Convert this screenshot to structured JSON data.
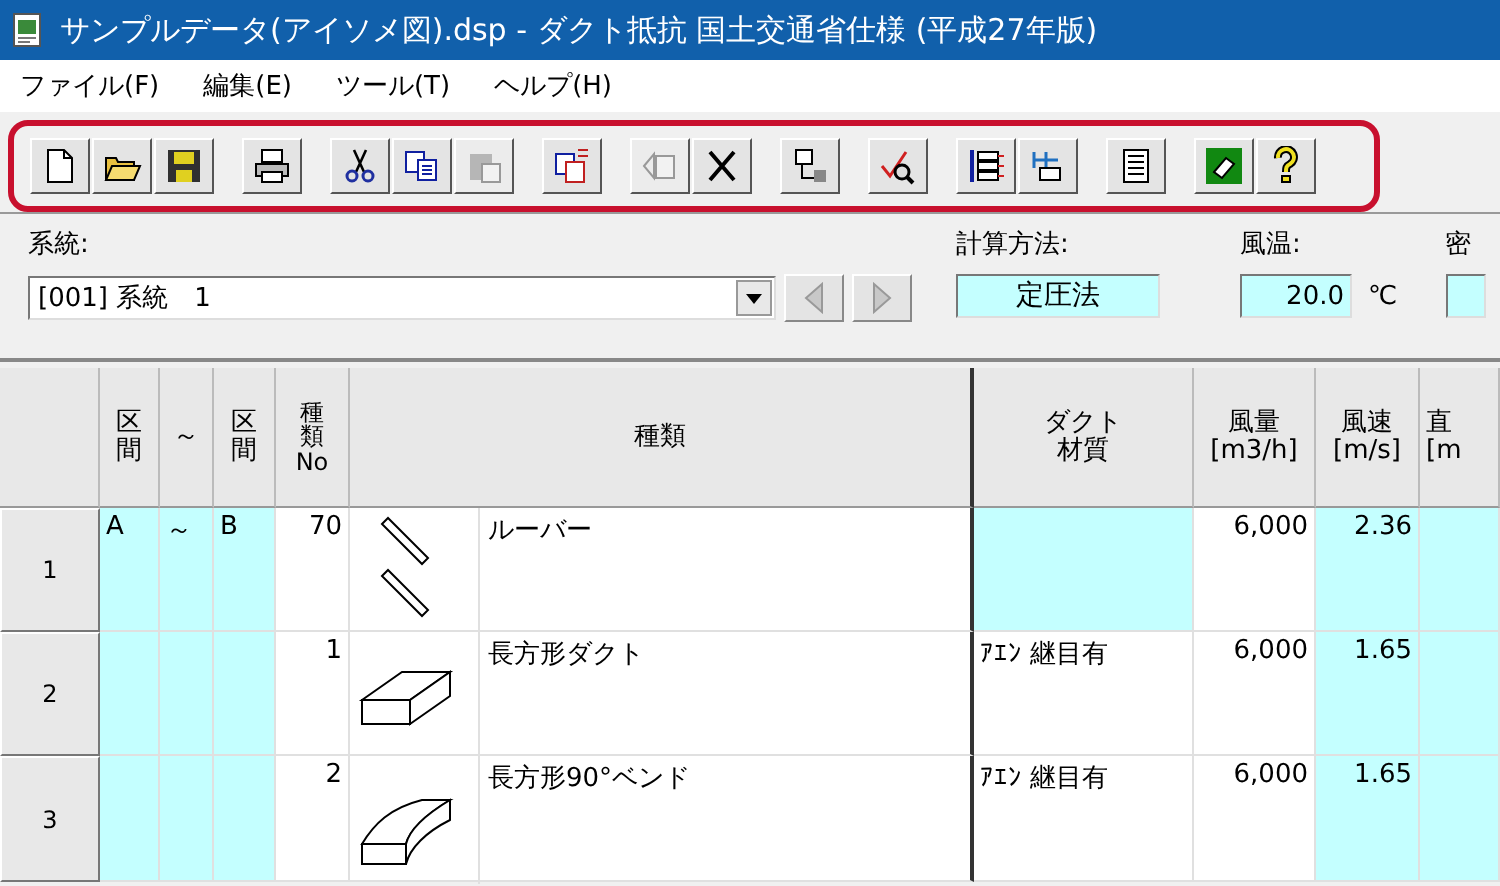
{
  "window": {
    "title": "サンプルデータ(アイソメ図).dsp - ダクト抵抗 国土交通省仕様 (平成27年版)"
  },
  "menu": [
    "ファイル(F)",
    "編集(E)",
    "ツール(T)",
    "ヘルプ(H)"
  ],
  "toolbar": {
    "highlighted": true,
    "groups": [
      [
        {
          "kind": "new",
          "disabled": false
        },
        {
          "kind": "open",
          "disabled": false
        },
        {
          "kind": "save",
          "disabled": false
        }
      ],
      [
        {
          "kind": "print",
          "disabled": false
        }
      ],
      [
        {
          "kind": "cut",
          "disabled": false
        },
        {
          "kind": "copy",
          "disabled": false
        },
        {
          "kind": "paste",
          "disabled": true
        }
      ],
      [
        {
          "kind": "export",
          "disabled": false
        }
      ],
      [
        {
          "kind": "insert",
          "disabled": true
        },
        {
          "kind": "delete",
          "disabled": false
        }
      ],
      [
        {
          "kind": "move",
          "disabled": false
        }
      ],
      [
        {
          "kind": "check",
          "disabled": false
        }
      ],
      [
        {
          "kind": "tree",
          "disabled": false
        },
        {
          "kind": "network",
          "disabled": false
        }
      ],
      [
        {
          "kind": "list",
          "disabled": false
        }
      ],
      [
        {
          "kind": "eraser",
          "disabled": false
        },
        {
          "kind": "help",
          "disabled": false
        }
      ]
    ]
  },
  "form": {
    "system": {
      "label": "系統:",
      "value": "[001] 系統　1",
      "prev_disabled": true,
      "next_disabled": true
    },
    "method": {
      "label": "計算方法:",
      "value": "定圧法"
    },
    "temperature": {
      "label": "風温:",
      "value": "20.0",
      "unit": "℃"
    },
    "column_3": {
      "label": "密"
    }
  },
  "table": {
    "columns": [
      {
        "lines": [
          "区",
          "間"
        ]
      },
      {
        "lines": [
          "～"
        ]
      },
      {
        "lines": [
          "区",
          "間"
        ]
      },
      {
        "lines": [
          "種",
          "類",
          "No"
        ]
      },
      {
        "lines": [
          "種類"
        ]
      },
      {
        "lines": [
          "ダクト",
          "材質"
        ]
      },
      {
        "lines": [
          "風量",
          "[m3/h]"
        ]
      },
      {
        "lines": [
          "風速",
          "[m/s]"
        ]
      },
      {
        "lines": [
          "直",
          "[m"
        ]
      }
    ],
    "rows": [
      {
        "number": "1",
        "cells": [
          {
            "text": "A",
            "shaded": true
          },
          {
            "text": "～",
            "shaded": true
          },
          {
            "text": "B",
            "shaded": true
          },
          {
            "text": "70",
            "shaded": false
          },
          {
            "kind": "louver",
            "text": "ルーバー",
            "shaded": false
          },
          {
            "shaded": true
          },
          {
            "text": "6,000",
            "shaded": false
          },
          {
            "text": "2.36",
            "shaded": true
          },
          {
            "shaded": true
          }
        ]
      },
      {
        "number": "2",
        "cells": [
          {
            "shaded": true
          },
          {
            "shaded": true
          },
          {
            "shaded": true
          },
          {
            "text": "1",
            "shaded": false
          },
          {
            "kind": "rect-duct",
            "text": "長方形ダクト",
            "shaded": false
          },
          {
            "text": "ｱｴﾝ 継目有",
            "shaded": false
          },
          {
            "text": "6,000",
            "shaded": false
          },
          {
            "text": "1.65",
            "shaded": true
          },
          {
            "shaded": true
          }
        ]
      },
      {
        "number": "3",
        "cells": [
          {
            "shaded": true
          },
          {
            "shaded": true
          },
          {
            "shaded": true
          },
          {
            "text": "2",
            "shaded": false
          },
          {
            "kind": "bend",
            "text": "長方形90°ベンド",
            "shaded": false
          },
          {
            "text": "ｱｴﾝ 継目有",
            "shaded": false
          },
          {
            "text": "6,000",
            "shaded": false
          },
          {
            "text": "1.65",
            "shaded": true
          },
          {
            "shaded": true
          }
        ]
      }
    ]
  }
}
